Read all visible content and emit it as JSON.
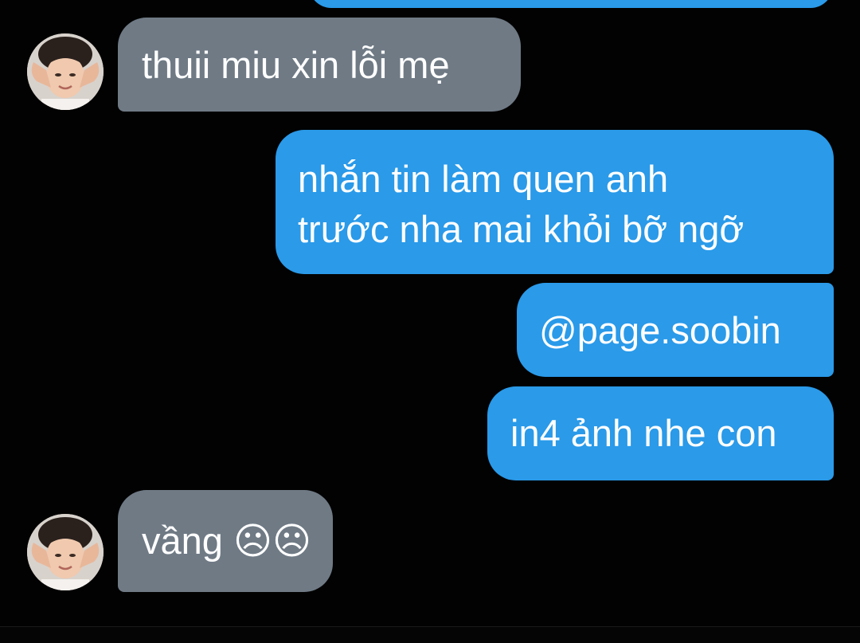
{
  "messages": [
    {
      "id": "m1",
      "direction": "incoming",
      "text": "thuii miu xin lỗi mẹ"
    },
    {
      "id": "m2",
      "direction": "outgoing",
      "lines": [
        "nhắn tin làm quen anh",
        "trước nha mai khỏi bỡ ngỡ"
      ]
    },
    {
      "id": "m3",
      "direction": "outgoing",
      "text": "@page.soobin"
    },
    {
      "id": "m4",
      "direction": "outgoing",
      "text": "in4 ảnh nhe con"
    },
    {
      "id": "m5",
      "direction": "incoming",
      "text": "vầng ☹☹"
    }
  ],
  "theme": {
    "background": "#020202",
    "incoming_bubble": "#6f7a85",
    "outgoing_bubble": "#2a9ae9",
    "text": "#ffffff"
  },
  "icons": {
    "avatar": "contact-avatar-icon"
  }
}
